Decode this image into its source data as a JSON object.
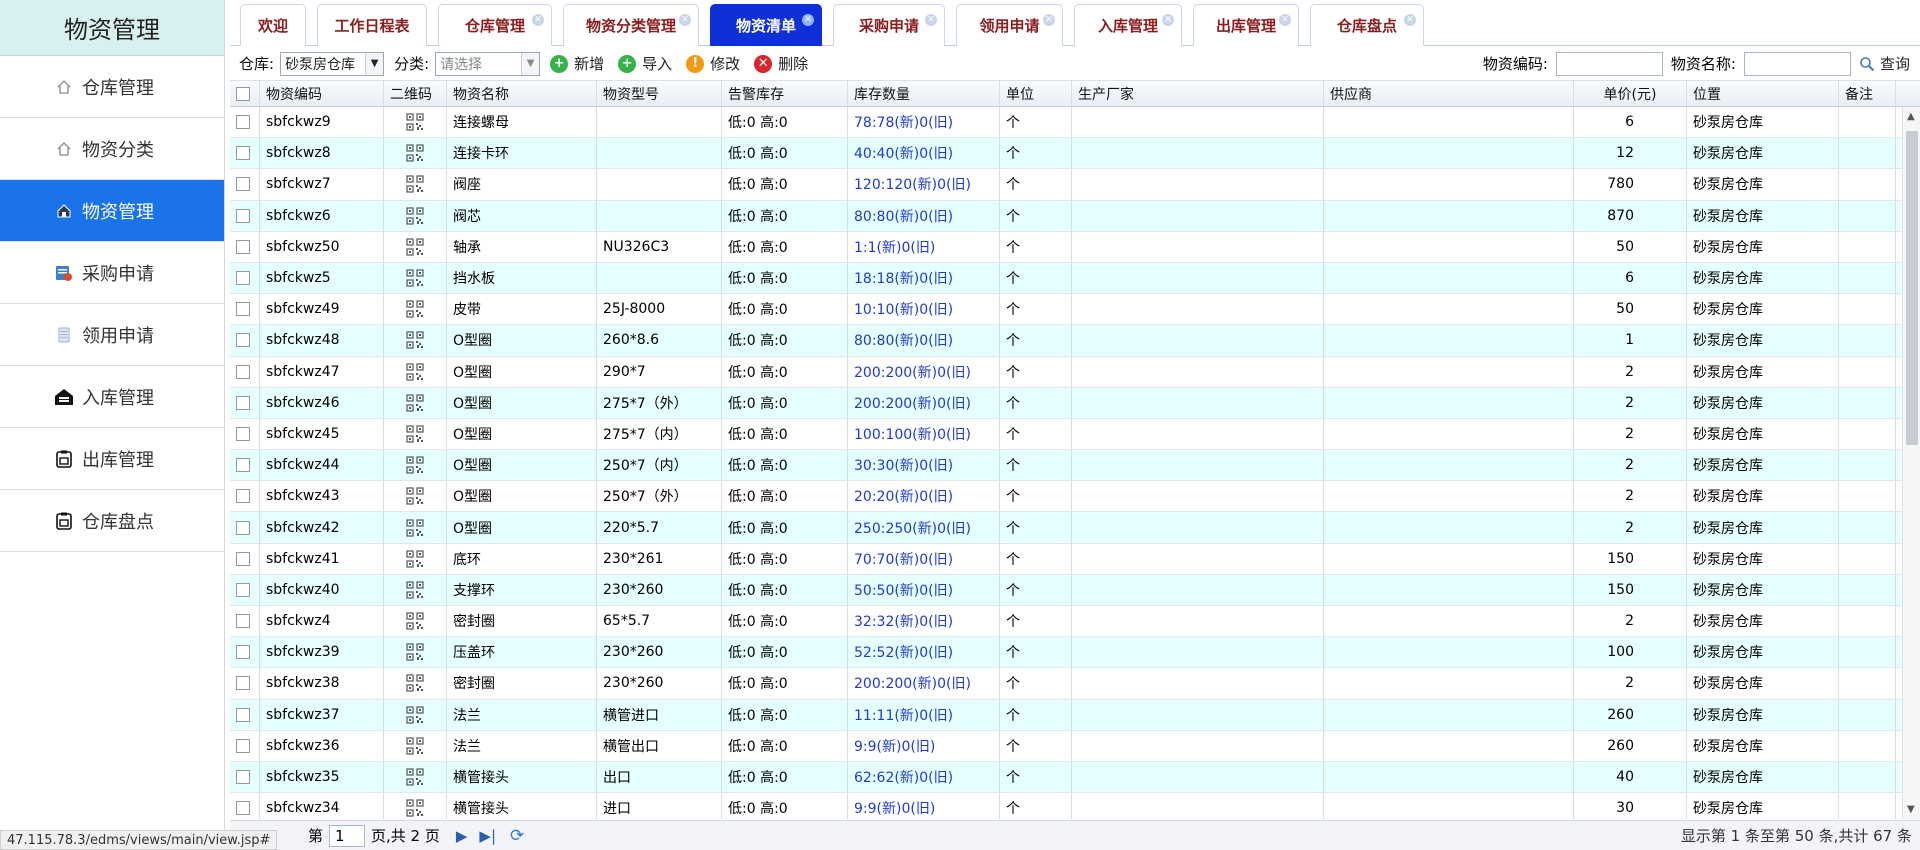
{
  "sidebar": {
    "title": "物资管理",
    "items": [
      {
        "label": "仓库管理",
        "icon": "home-icon",
        "active": false
      },
      {
        "label": "物资分类",
        "icon": "home-icon",
        "active": false
      },
      {
        "label": "物资管理",
        "icon": "building-icon",
        "active": true
      },
      {
        "label": "采购申请",
        "icon": "purchase-icon",
        "active": false
      },
      {
        "label": "领用申请",
        "icon": "document-icon",
        "active": false
      },
      {
        "label": "入库管理",
        "icon": "warehouse-in-icon",
        "active": false
      },
      {
        "label": "出库管理",
        "icon": "clipboard-icon",
        "active": false
      },
      {
        "label": "仓库盘点",
        "icon": "clipboard-icon",
        "active": false
      }
    ]
  },
  "tabs": [
    {
      "label": "欢迎",
      "closable": false
    },
    {
      "label": "工作日程表",
      "closable": false
    },
    {
      "label": "仓库管理",
      "closable": true
    },
    {
      "label": "物资分类管理",
      "closable": true
    },
    {
      "label": "物资清单",
      "closable": true,
      "active": true
    },
    {
      "label": "采购申请",
      "closable": true
    },
    {
      "label": "领用申请",
      "closable": true
    },
    {
      "label": "入库管理",
      "closable": true
    },
    {
      "label": "出库管理",
      "closable": true
    },
    {
      "label": "仓库盘点",
      "closable": true
    }
  ],
  "toolbar": {
    "warehouse_label": "仓库:",
    "warehouse_value": "砂泵房仓库",
    "category_label": "分类:",
    "category_placeholder": "请选择",
    "add_label": "新增",
    "import_label": "导入",
    "edit_label": "修改",
    "delete_label": "删除",
    "code_label": "物资编码:",
    "name_label": "物资名称:",
    "query_label": "查询"
  },
  "table": {
    "columns": [
      "物资编码",
      "二维码",
      "物资名称",
      "物资型号",
      "告警库存",
      "库存数量",
      "单位",
      "生产厂家",
      "供应商",
      "单价(元)",
      "位置",
      "备注"
    ],
    "rows": [
      [
        "sbfckwz9",
        "连接螺母",
        "",
        "低:0 高:0",
        "78:78(新)0(旧)",
        "个",
        "",
        "",
        "6",
        "砂泵房仓库",
        ""
      ],
      [
        "sbfckwz8",
        "连接卡环",
        "",
        "低:0 高:0",
        "40:40(新)0(旧)",
        "个",
        "",
        "",
        "12",
        "砂泵房仓库",
        ""
      ],
      [
        "sbfckwz7",
        "阀座",
        "",
        "低:0 高:0",
        "120:120(新)0(旧)",
        "个",
        "",
        "",
        "780",
        "砂泵房仓库",
        ""
      ],
      [
        "sbfckwz6",
        "阀芯",
        "",
        "低:0 高:0",
        "80:80(新)0(旧)",
        "个",
        "",
        "",
        "870",
        "砂泵房仓库",
        ""
      ],
      [
        "sbfckwz50",
        "轴承",
        "NU326C3",
        "低:0 高:0",
        "1:1(新)0(旧)",
        "个",
        "",
        "",
        "50",
        "砂泵房仓库",
        ""
      ],
      [
        "sbfckwz5",
        "挡水板",
        "",
        "低:0 高:0",
        "18:18(新)0(旧)",
        "个",
        "",
        "",
        "6",
        "砂泵房仓库",
        ""
      ],
      [
        "sbfckwz49",
        "皮带",
        "25J-8000",
        "低:0 高:0",
        "10:10(新)0(旧)",
        "个",
        "",
        "",
        "50",
        "砂泵房仓库",
        ""
      ],
      [
        "sbfckwz48",
        "O型圈",
        "260*8.6",
        "低:0 高:0",
        "80:80(新)0(旧)",
        "个",
        "",
        "",
        "1",
        "砂泵房仓库",
        ""
      ],
      [
        "sbfckwz47",
        "O型圈",
        "290*7",
        "低:0 高:0",
        "200:200(新)0(旧)",
        "个",
        "",
        "",
        "2",
        "砂泵房仓库",
        ""
      ],
      [
        "sbfckwz46",
        "O型圈",
        "275*7（外）",
        "低:0 高:0",
        "200:200(新)0(旧)",
        "个",
        "",
        "",
        "2",
        "砂泵房仓库",
        ""
      ],
      [
        "sbfckwz45",
        "O型圈",
        "275*7（内）",
        "低:0 高:0",
        "100:100(新)0(旧)",
        "个",
        "",
        "",
        "2",
        "砂泵房仓库",
        ""
      ],
      [
        "sbfckwz44",
        "O型圈",
        "250*7（内）",
        "低:0 高:0",
        "30:30(新)0(旧)",
        "个",
        "",
        "",
        "2",
        "砂泵房仓库",
        ""
      ],
      [
        "sbfckwz43",
        "O型圈",
        "250*7（外）",
        "低:0 高:0",
        "20:20(新)0(旧)",
        "个",
        "",
        "",
        "2",
        "砂泵房仓库",
        ""
      ],
      [
        "sbfckwz42",
        "O型圈",
        "220*5.7",
        "低:0 高:0",
        "250:250(新)0(旧)",
        "个",
        "",
        "",
        "2",
        "砂泵房仓库",
        ""
      ],
      [
        "sbfckwz41",
        "底环",
        "230*261",
        "低:0 高:0",
        "70:70(新)0(旧)",
        "个",
        "",
        "",
        "150",
        "砂泵房仓库",
        ""
      ],
      [
        "sbfckwz40",
        "支撑环",
        "230*260",
        "低:0 高:0",
        "50:50(新)0(旧)",
        "个",
        "",
        "",
        "150",
        "砂泵房仓库",
        ""
      ],
      [
        "sbfckwz4",
        "密封圈",
        "65*5.7",
        "低:0 高:0",
        "32:32(新)0(旧)",
        "个",
        "",
        "",
        "2",
        "砂泵房仓库",
        ""
      ],
      [
        "sbfckwz39",
        "压盖环",
        "230*260",
        "低:0 高:0",
        "52:52(新)0(旧)",
        "个",
        "",
        "",
        "100",
        "砂泵房仓库",
        ""
      ],
      [
        "sbfckwz38",
        "密封圈",
        "230*260",
        "低:0 高:0",
        "200:200(新)0(旧)",
        "个",
        "",
        "",
        "2",
        "砂泵房仓库",
        ""
      ],
      [
        "sbfckwz37",
        "法兰",
        "横管进口",
        "低:0 高:0",
        "11:11(新)0(旧)",
        "个",
        "",
        "",
        "260",
        "砂泵房仓库",
        ""
      ],
      [
        "sbfckwz36",
        "法兰",
        "横管出口",
        "低:0 高:0",
        "9:9(新)0(旧)",
        "个",
        "",
        "",
        "260",
        "砂泵房仓库",
        ""
      ],
      [
        "sbfckwz35",
        "横管接头",
        "出口",
        "低:0 高:0",
        "62:62(新)0(旧)",
        "个",
        "",
        "",
        "40",
        "砂泵房仓库",
        ""
      ],
      [
        "sbfckwz34",
        "横管接头",
        "进口",
        "低:0 高:0",
        "9:9(新)0(旧)",
        "个",
        "",
        "",
        "30",
        "砂泵房仓库",
        ""
      ]
    ]
  },
  "pager": {
    "page_prefix": "第",
    "page_value": "1",
    "page_suffix": "页,共 2 页",
    "summary": "显示第 1 条至第 50 条,共计 67 条"
  },
  "status_url": "47.115.78.3/edms/views/main/view.jsp#",
  "colors": {
    "accent": "#1a73e8",
    "active_tab": "#0f2fd8",
    "row_alt": "#e6ffff",
    "stock_text": "#1f3bd6"
  }
}
